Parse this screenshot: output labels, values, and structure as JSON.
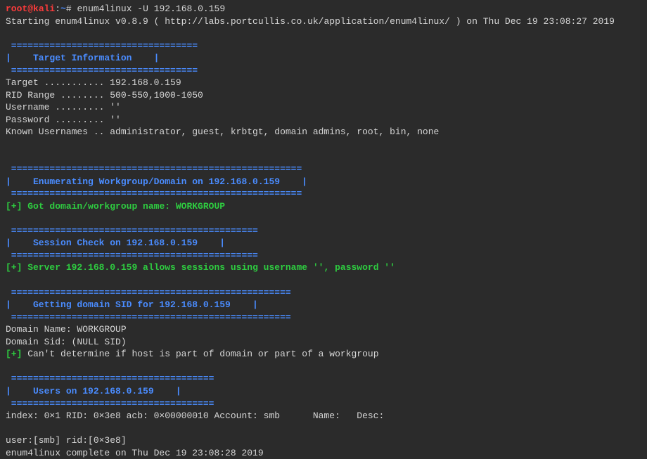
{
  "prompt": {
    "user": "root",
    "at": "@",
    "host": "kali",
    "colon": ":",
    "tilde": "~",
    "hash": "#",
    "command": " enum4linux -U 192.168.0.159"
  },
  "start_line": "Starting enum4linux v0.8.9 ( http://labs.portcullis.co.uk/application/enum4linux/ ) on Thu Dec 19 23:08:27 2019",
  "target_section": {
    "border_top": " ================================== ",
    "title": "|    Target Information    |",
    "border_bot": " ================================== "
  },
  "target_info": {
    "target_label": "Target ........... 192.168.0.159",
    "rid_label": "RID Range ........ 500-550,1000-1050",
    "username_label": "Username ......... ''",
    "password_label": "Password ......... ''",
    "known_label": "Known Usernames .. administrator, guest, krbtgt, domain admins, root, bin, none"
  },
  "workgroup_section": {
    "border": " ===================================================== ",
    "title": "|    Enumerating Workgroup/Domain on 192.168.0.159    |"
  },
  "workgroup_result": {
    "plus": "[+] ",
    "text": "Got domain/workgroup name: WORKGROUP"
  },
  "session_section": {
    "border": " ============================================= ",
    "title": "|    Session Check on 192.168.0.159    |"
  },
  "session_result": {
    "plus": "[+] ",
    "text": "Server 192.168.0.159 allows sessions using username '', password ''"
  },
  "sid_section": {
    "border": " =================================================== ",
    "title": "|    Getting domain SID for 192.168.0.159    |"
  },
  "sid_info": {
    "domain_name": "Domain Name: WORKGROUP",
    "domain_sid": "Domain Sid: (NULL SID)"
  },
  "sid_result": {
    "plus": "[+] ",
    "text": "Can't determine if host is part of domain or part of a workgroup"
  },
  "users_section": {
    "border": " ===================================== ",
    "title": "|    Users on 192.168.0.159    |"
  },
  "users_info": {
    "index_line": "index: 0×1 RID: 0×3e8 acb: 0×00000010 Account: smb      Name:   Desc:",
    "user_line": "user:[smb] rid:[0×3e8]"
  },
  "complete_line": "enum4linux complete on Thu Dec 19 23:08:28 2019"
}
